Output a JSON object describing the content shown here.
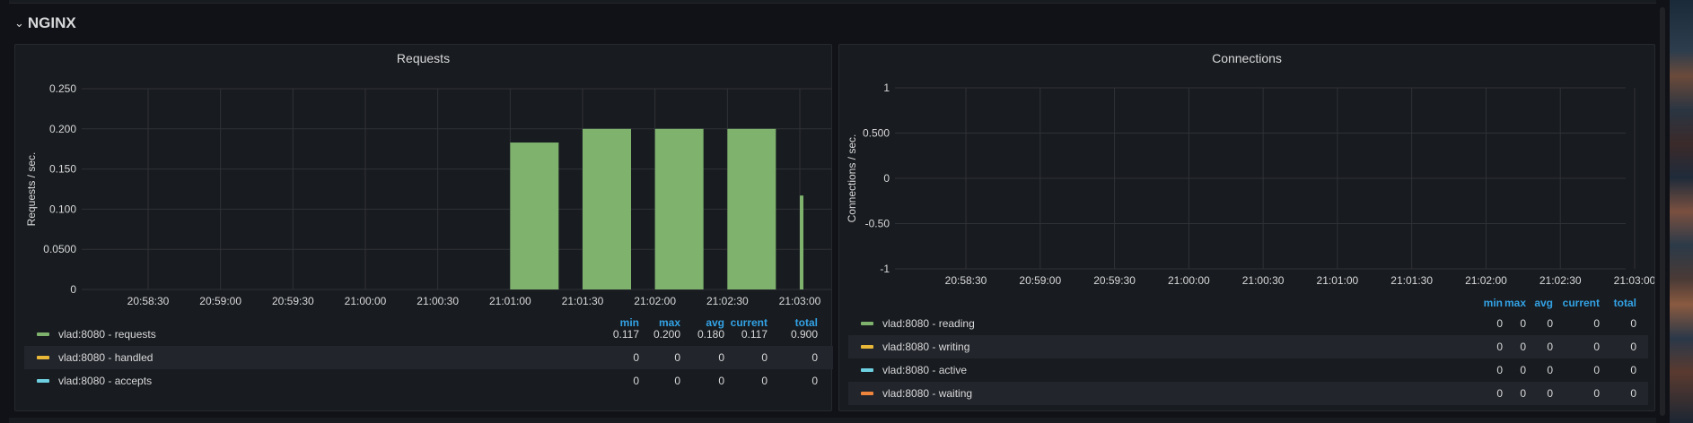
{
  "row": {
    "title": "NGINX",
    "chevron": "⌄"
  },
  "panels": {
    "requests": {
      "title": "Requests",
      "legend_headers": [
        "min",
        "max",
        "avg",
        "current",
        "total"
      ],
      "legend": [
        {
          "label": "vlad:8080 - requests",
          "color": "#7eb26d",
          "min": "0.117",
          "max": "0.200",
          "avg": "0.180",
          "current": "0.117",
          "total": "0.900"
        },
        {
          "label": "vlad:8080 - handled",
          "color": "#eab839",
          "min": "0",
          "max": "0",
          "avg": "0",
          "current": "0",
          "total": "0"
        },
        {
          "label": "vlad:8080 - accepts",
          "color": "#6ed0e0",
          "min": "0",
          "max": "0",
          "avg": "0",
          "current": "0",
          "total": "0"
        }
      ]
    },
    "connections": {
      "title": "Connections",
      "legend_headers": [
        "min",
        "max",
        "avg",
        "current",
        "total"
      ],
      "legend": [
        {
          "label": "vlad:8080 - reading",
          "color": "#7eb26d",
          "min": "0",
          "max": "0",
          "avg": "0",
          "current": "0",
          "total": "0"
        },
        {
          "label": "vlad:8080 - writing",
          "color": "#eab839",
          "min": "0",
          "max": "0",
          "avg": "0",
          "current": "0",
          "total": "0"
        },
        {
          "label": "vlad:8080 - active",
          "color": "#6ed0e0",
          "min": "0",
          "max": "0",
          "avg": "0",
          "current": "0",
          "total": "0"
        },
        {
          "label": "vlad:8080 - waiting",
          "color": "#ef843c",
          "min": "0",
          "max": "0",
          "avg": "0",
          "current": "0",
          "total": "0"
        }
      ]
    }
  },
  "chart_data": [
    {
      "type": "bar",
      "title": "Requests",
      "ylabel": "Requests / sec.",
      "xlabel": "",
      "x_ticks": [
        "20:58:30",
        "20:59:00",
        "20:59:30",
        "21:00:00",
        "21:00:30",
        "21:01:00",
        "21:01:30",
        "21:02:00",
        "21:02:30",
        "21:03:00"
      ],
      "y_ticks": [
        "0",
        "0.0500",
        "0.100",
        "0.150",
        "0.200",
        "0.250"
      ],
      "ylim": [
        0,
        0.25
      ],
      "grid": true,
      "series": [
        {
          "name": "vlad:8080 - requests",
          "color": "#7eb26d",
          "x": [
            "21:01:00",
            "21:01:30",
            "21:02:00",
            "21:02:30",
            "21:03:00"
          ],
          "values": [
            0.183,
            0.2,
            0.2,
            0.2,
            0.117
          ]
        }
      ]
    },
    {
      "type": "line",
      "title": "Connections",
      "ylabel": "Connections / sec.",
      "xlabel": "",
      "x_ticks": [
        "20:58:30",
        "20:59:00",
        "20:59:30",
        "21:00:00",
        "21:00:30",
        "21:01:00",
        "21:01:30",
        "21:02:00",
        "21:02:30",
        "21:03:00"
      ],
      "y_ticks": [
        "-1",
        "-0.50",
        "0",
        "0.500",
        "1"
      ],
      "ylim": [
        -1,
        1
      ],
      "grid": true,
      "series": []
    }
  ]
}
